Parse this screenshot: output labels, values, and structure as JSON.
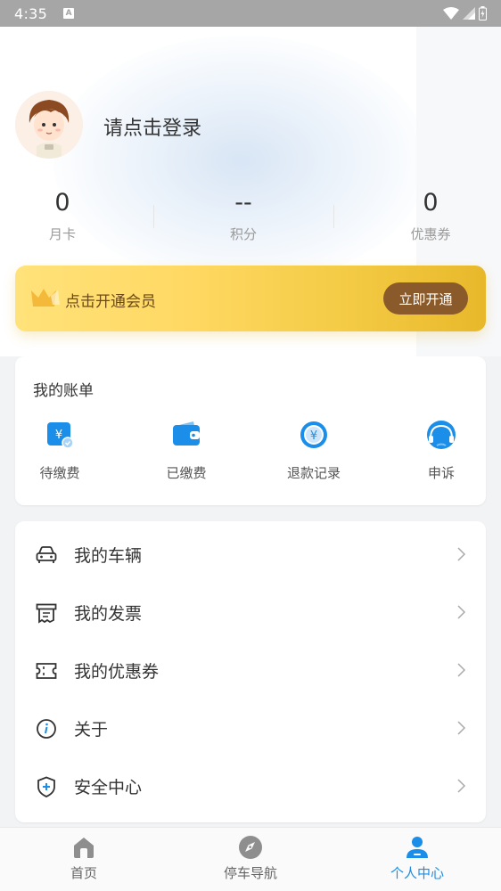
{
  "status_bar": {
    "time": "4:35",
    "badge": "A"
  },
  "header": {
    "login_prompt": "请点击登录",
    "stats": [
      {
        "value": "0",
        "label": "月卡"
      },
      {
        "value": "--",
        "label": "积分"
      },
      {
        "value": "0",
        "label": "优惠券"
      }
    ]
  },
  "member": {
    "text": "点击开通会员",
    "button": "立即开通"
  },
  "bills": {
    "title": "我的账单",
    "items": [
      {
        "label": "待缴费",
        "icon": "pending-payment-icon"
      },
      {
        "label": "已缴费",
        "icon": "wallet-icon"
      },
      {
        "label": "退款记录",
        "icon": "refund-icon"
      },
      {
        "label": "申诉",
        "icon": "customer-service-icon"
      }
    ]
  },
  "menu": {
    "items": [
      {
        "label": "我的车辆",
        "icon": "car-icon"
      },
      {
        "label": "我的发票",
        "icon": "invoice-icon"
      },
      {
        "label": "我的优惠券",
        "icon": "coupon-icon"
      },
      {
        "label": "关于",
        "icon": "info-icon"
      },
      {
        "label": "安全中心",
        "icon": "shield-icon"
      }
    ]
  },
  "bottom_nav": {
    "items": [
      {
        "label": "首页",
        "icon": "home-icon",
        "active": false
      },
      {
        "label": "停车导航",
        "icon": "compass-icon",
        "active": false
      },
      {
        "label": "个人中心",
        "icon": "person-icon",
        "active": true
      }
    ]
  },
  "colors": {
    "accent": "#1a8ee8",
    "member_gold": "#f4cb45",
    "member_button": "#8a5a2b",
    "status_bar": "#a6a6a6"
  }
}
